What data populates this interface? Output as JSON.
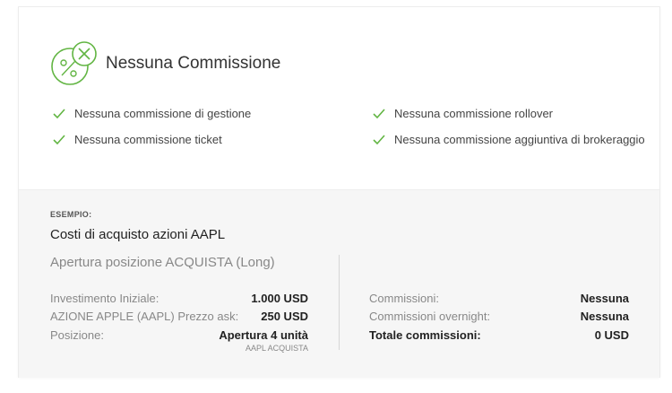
{
  "title": "Nessuna Commissione",
  "features": [
    "Nessuna commissione di gestione",
    "Nessuna commissione ticket",
    "Nessuna commissione rollover",
    "Nessuna commissione aggiuntiva di brokeraggio"
  ],
  "example": {
    "label": "ESEMPIO:",
    "title": "Costi di acquisto azioni AAPL",
    "position_title": "Apertura posizione ACQUISTA (Long)",
    "left_rows": [
      {
        "label": "Investimento Iniziale:",
        "value": "1.000 USD"
      },
      {
        "label": "AZIONE APPLE (AAPL) Prezzo ask:",
        "value": "250 USD"
      },
      {
        "label": "Posizione:",
        "value": "Apertura 4 unità",
        "note": "AAPL ACQUISTA"
      }
    ],
    "right_rows": [
      {
        "label": "Commissioni:",
        "value": "Nessuna"
      },
      {
        "label": "Commissioni overnight:",
        "value": "Nessuna"
      },
      {
        "label": "Totale commissioni:",
        "value": "0 USD"
      }
    ]
  },
  "colors": {
    "accent": "#62b543",
    "background_bottom": "#f6f6f6"
  },
  "icons": {
    "logo": "percent-cross-icon",
    "check": "check-icon"
  }
}
